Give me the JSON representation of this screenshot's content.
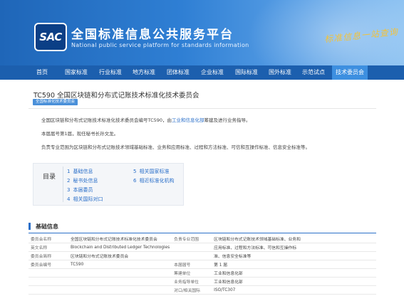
{
  "header": {
    "logo_text": "SAC",
    "title": "全国标准信息公共服务平台",
    "subtitle": "National public service platform  for standards information",
    "slogan": "标准信息一站查询"
  },
  "nav": {
    "items": [
      "首页",
      "国家标准",
      "行业标准",
      "地方标准",
      "团体标准",
      "企业标准",
      "国际标准",
      "国外标准",
      "示范试点",
      "技术委员会"
    ],
    "active_index": 9
  },
  "page": {
    "title": "TC590 全国区块链和分布式记账技术标准化技术委员会",
    "tag": "全国标准化技术委员会",
    "intro_prefix": "全国区块链和分布式记账技术标准化技术委员会编号TC590，由",
    "intro_link": "工业和信息化部",
    "intro_suffix": "筹建及进行业务指导。",
    "session_line": "本届届号第1届，现任秘书长孙文龙。",
    "scope_line": "负责专业范围为区块链和分布式记账技术领域基础标准、业务和应用标准、过程和方法标准、可信和互操作标准、信息安全标准等。"
  },
  "toc": {
    "title": "目录",
    "items": [
      {
        "num": "1",
        "label": "基础信息"
      },
      {
        "num": "2",
        "label": "秘书处信息"
      },
      {
        "num": "3",
        "label": "本届委员"
      },
      {
        "num": "4",
        "label": "相关国际对口"
      },
      {
        "num": "5",
        "label": "相关国家标准"
      },
      {
        "num": "6",
        "label": "相近标准化机构"
      }
    ]
  },
  "basic_info": {
    "section_title": "基础信息",
    "rows": [
      {
        "l1": "委员会名称",
        "v1": "全国区块链和分布式记账技术标准化技术委员会",
        "l2": "负责专业范围",
        "v2": "区块链和分布式记账技术领域基础标准、业务和"
      },
      {
        "l1": "英文名称",
        "v1": "Blockchain and Distributed Ledger Technologies",
        "l2": "",
        "v2": "应用标准、过程和方法标准、可信和互操作标"
      },
      {
        "l1": "委员会简称",
        "v1": "区块链和分布式记账技术委员会",
        "l2": "",
        "v2": "准、信息安全标准等"
      },
      {
        "l1": "委员会编号",
        "v1": "TC590",
        "l2": "本届届号",
        "v2": "第 1 届"
      },
      {
        "l1": "",
        "v1": "",
        "l2": "筹建单位",
        "v2": "工业和信息化部"
      },
      {
        "l1": "",
        "v1": "",
        "l2": "业务指导单位",
        "v2": "工业和信息化部"
      },
      {
        "l1": "",
        "v1": "",
        "l2": "对口/相关国际",
        "v2": "ISO/TC307"
      }
    ]
  }
}
